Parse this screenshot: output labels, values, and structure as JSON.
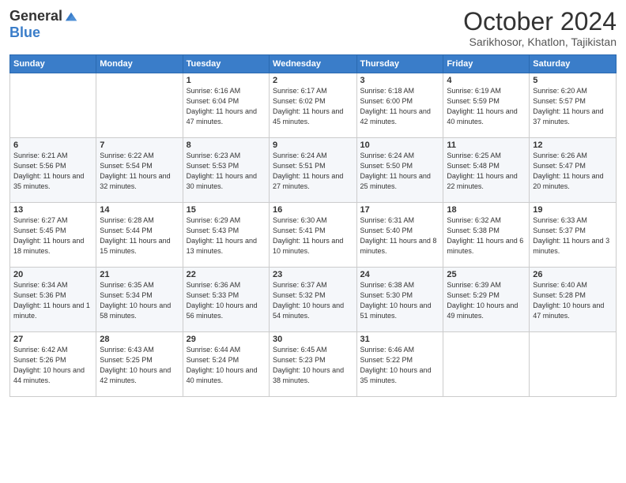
{
  "header": {
    "logo_general": "General",
    "logo_blue": "Blue",
    "month": "October 2024",
    "location": "Sarikhosor, Khatlon, Tajikistan"
  },
  "weekdays": [
    "Sunday",
    "Monday",
    "Tuesday",
    "Wednesday",
    "Thursday",
    "Friday",
    "Saturday"
  ],
  "weeks": [
    [
      {
        "day": "",
        "info": ""
      },
      {
        "day": "",
        "info": ""
      },
      {
        "day": "1",
        "info": "Sunrise: 6:16 AM\nSunset: 6:04 PM\nDaylight: 11 hours and 47 minutes."
      },
      {
        "day": "2",
        "info": "Sunrise: 6:17 AM\nSunset: 6:02 PM\nDaylight: 11 hours and 45 minutes."
      },
      {
        "day": "3",
        "info": "Sunrise: 6:18 AM\nSunset: 6:00 PM\nDaylight: 11 hours and 42 minutes."
      },
      {
        "day": "4",
        "info": "Sunrise: 6:19 AM\nSunset: 5:59 PM\nDaylight: 11 hours and 40 minutes."
      },
      {
        "day": "5",
        "info": "Sunrise: 6:20 AM\nSunset: 5:57 PM\nDaylight: 11 hours and 37 minutes."
      }
    ],
    [
      {
        "day": "6",
        "info": "Sunrise: 6:21 AM\nSunset: 5:56 PM\nDaylight: 11 hours and 35 minutes."
      },
      {
        "day": "7",
        "info": "Sunrise: 6:22 AM\nSunset: 5:54 PM\nDaylight: 11 hours and 32 minutes."
      },
      {
        "day": "8",
        "info": "Sunrise: 6:23 AM\nSunset: 5:53 PM\nDaylight: 11 hours and 30 minutes."
      },
      {
        "day": "9",
        "info": "Sunrise: 6:24 AM\nSunset: 5:51 PM\nDaylight: 11 hours and 27 minutes."
      },
      {
        "day": "10",
        "info": "Sunrise: 6:24 AM\nSunset: 5:50 PM\nDaylight: 11 hours and 25 minutes."
      },
      {
        "day": "11",
        "info": "Sunrise: 6:25 AM\nSunset: 5:48 PM\nDaylight: 11 hours and 22 minutes."
      },
      {
        "day": "12",
        "info": "Sunrise: 6:26 AM\nSunset: 5:47 PM\nDaylight: 11 hours and 20 minutes."
      }
    ],
    [
      {
        "day": "13",
        "info": "Sunrise: 6:27 AM\nSunset: 5:45 PM\nDaylight: 11 hours and 18 minutes."
      },
      {
        "day": "14",
        "info": "Sunrise: 6:28 AM\nSunset: 5:44 PM\nDaylight: 11 hours and 15 minutes."
      },
      {
        "day": "15",
        "info": "Sunrise: 6:29 AM\nSunset: 5:43 PM\nDaylight: 11 hours and 13 minutes."
      },
      {
        "day": "16",
        "info": "Sunrise: 6:30 AM\nSunset: 5:41 PM\nDaylight: 11 hours and 10 minutes."
      },
      {
        "day": "17",
        "info": "Sunrise: 6:31 AM\nSunset: 5:40 PM\nDaylight: 11 hours and 8 minutes."
      },
      {
        "day": "18",
        "info": "Sunrise: 6:32 AM\nSunset: 5:38 PM\nDaylight: 11 hours and 6 minutes."
      },
      {
        "day": "19",
        "info": "Sunrise: 6:33 AM\nSunset: 5:37 PM\nDaylight: 11 hours and 3 minutes."
      }
    ],
    [
      {
        "day": "20",
        "info": "Sunrise: 6:34 AM\nSunset: 5:36 PM\nDaylight: 11 hours and 1 minute."
      },
      {
        "day": "21",
        "info": "Sunrise: 6:35 AM\nSunset: 5:34 PM\nDaylight: 10 hours and 58 minutes."
      },
      {
        "day": "22",
        "info": "Sunrise: 6:36 AM\nSunset: 5:33 PM\nDaylight: 10 hours and 56 minutes."
      },
      {
        "day": "23",
        "info": "Sunrise: 6:37 AM\nSunset: 5:32 PM\nDaylight: 10 hours and 54 minutes."
      },
      {
        "day": "24",
        "info": "Sunrise: 6:38 AM\nSunset: 5:30 PM\nDaylight: 10 hours and 51 minutes."
      },
      {
        "day": "25",
        "info": "Sunrise: 6:39 AM\nSunset: 5:29 PM\nDaylight: 10 hours and 49 minutes."
      },
      {
        "day": "26",
        "info": "Sunrise: 6:40 AM\nSunset: 5:28 PM\nDaylight: 10 hours and 47 minutes."
      }
    ],
    [
      {
        "day": "27",
        "info": "Sunrise: 6:42 AM\nSunset: 5:26 PM\nDaylight: 10 hours and 44 minutes."
      },
      {
        "day": "28",
        "info": "Sunrise: 6:43 AM\nSunset: 5:25 PM\nDaylight: 10 hours and 42 minutes."
      },
      {
        "day": "29",
        "info": "Sunrise: 6:44 AM\nSunset: 5:24 PM\nDaylight: 10 hours and 40 minutes."
      },
      {
        "day": "30",
        "info": "Sunrise: 6:45 AM\nSunset: 5:23 PM\nDaylight: 10 hours and 38 minutes."
      },
      {
        "day": "31",
        "info": "Sunrise: 6:46 AM\nSunset: 5:22 PM\nDaylight: 10 hours and 35 minutes."
      },
      {
        "day": "",
        "info": ""
      },
      {
        "day": "",
        "info": ""
      }
    ]
  ]
}
